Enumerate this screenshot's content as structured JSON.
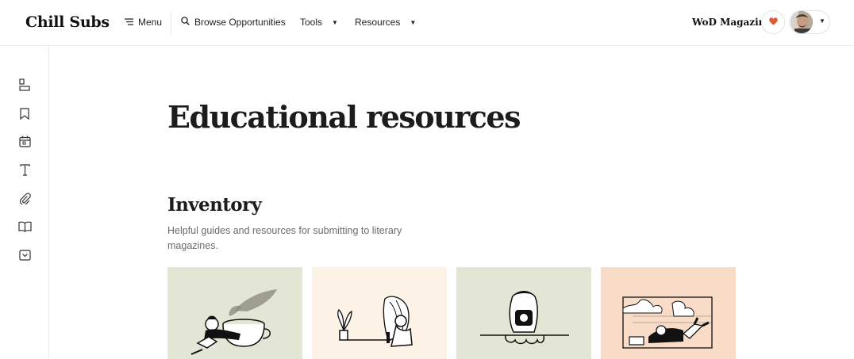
{
  "header": {
    "logo": "Chill Subs",
    "nav": {
      "menu": "Menu",
      "browse": "Browse Opportunities",
      "tools": "Tools",
      "resources": "Resources"
    },
    "magazine": "WoD Magazine",
    "icons": {
      "menu": "menu-lines-icon",
      "search": "search-icon",
      "heart": "heart-icon",
      "caret": "caret-down-icon"
    },
    "accent_heart": "#e05a3a"
  },
  "sidebar": {
    "icons": [
      "dashboard-icon",
      "bookmark-icon",
      "calendar-icon",
      "text-icon",
      "paperclip-icon",
      "book-icon",
      "inbox-icon"
    ]
  },
  "main": {
    "title": "Educational resources",
    "section": {
      "title": "Inventory",
      "description": "Helpful guides and resources for submitting to literary magazines."
    },
    "cards": [
      {
        "bg": "#e3e6d4",
        "illustration": "person-lying-on-cup"
      },
      {
        "bg": "#fcf3e6",
        "illustration": "person-with-plants"
      },
      {
        "bg": "#e3e6d4",
        "illustration": "person-with-phone"
      },
      {
        "bg": "#f8dcc7",
        "illustration": "person-with-laptop"
      }
    ]
  }
}
